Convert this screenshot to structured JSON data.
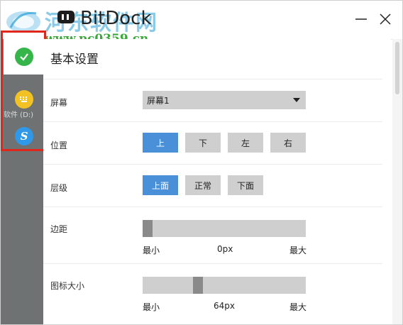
{
  "window": {
    "title": "BitDock"
  },
  "watermark": {
    "site_name": "河东软件网",
    "url": "www.pc0359.cn"
  },
  "sidebar": {
    "label": "软件 (D:)",
    "items": [
      {
        "icon": "check-circle-icon",
        "active": true
      },
      {
        "icon": "keyboard-icon",
        "active": false
      },
      {
        "icon": "s-logo-icon",
        "glyph": "S",
        "active": false
      }
    ]
  },
  "settings": {
    "title": "基本设置",
    "screen": {
      "label": "屏幕",
      "value": "屏幕1"
    },
    "position": {
      "label": "位置",
      "options": [
        "上",
        "下",
        "左",
        "右"
      ],
      "selected": "上"
    },
    "layer": {
      "label": "层级",
      "options": [
        "上面",
        "正常",
        "下面"
      ],
      "selected": "上面"
    },
    "margin": {
      "label": "边距",
      "min": "最小",
      "current": "0px",
      "max": "最大",
      "fraction": 0.0
    },
    "icon_size": {
      "label": "图标大小",
      "min": "最小",
      "current": "64px",
      "max": "最大",
      "fraction": 0.33
    }
  },
  "colors": {
    "accent": "#4a90d9",
    "sidebar": "#6f7272",
    "highlight_frame": "#e1261c",
    "check": "#35b54a",
    "keyboard": "#f2c224",
    "s_logo": "#2f98e8"
  }
}
